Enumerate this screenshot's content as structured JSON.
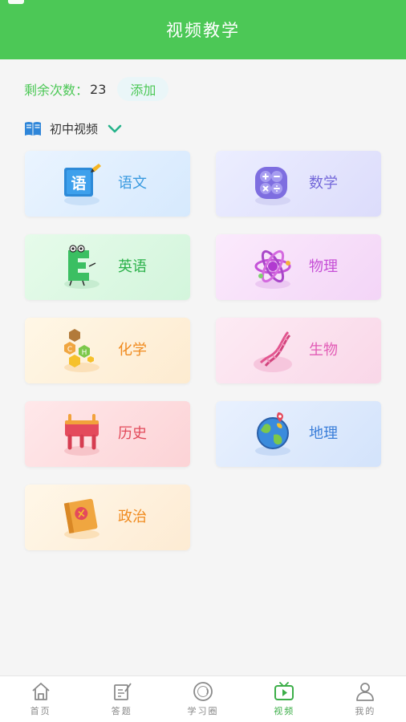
{
  "header": {
    "title": "视频教学"
  },
  "remain": {
    "label": "剩余次数：",
    "count": "23",
    "add_label": "添加"
  },
  "category": {
    "label": "初中视频"
  },
  "subjects": [
    {
      "label": "语文",
      "icon": "chinese-book-icon",
      "color": "#3b9be0"
    },
    {
      "label": "数学",
      "icon": "math-symbols-icon",
      "color": "#7367d9"
    },
    {
      "label": "英语",
      "icon": "letter-e-mascot-icon",
      "color": "#2bb14a"
    },
    {
      "label": "物理",
      "icon": "atom-icon",
      "color": "#c64fd6"
    },
    {
      "label": "化学",
      "icon": "molecule-icon",
      "color": "#f08a1e"
    },
    {
      "label": "生物",
      "icon": "dna-icon",
      "color": "#e25bb6"
    },
    {
      "label": "历史",
      "icon": "ancient-ding-icon",
      "color": "#e24a5a"
    },
    {
      "label": "地理",
      "icon": "globe-icon",
      "color": "#3a7ed9"
    },
    {
      "label": "政治",
      "icon": "party-book-icon",
      "color": "#f08a1e"
    }
  ],
  "tabbar": {
    "items": [
      {
        "label": "首页",
        "icon": "home-icon"
      },
      {
        "label": "答题",
        "icon": "edit-answer-icon"
      },
      {
        "label": "学习圈",
        "icon": "circle-icon"
      },
      {
        "label": "视频",
        "icon": "video-play-icon",
        "active": true
      },
      {
        "label": "我的",
        "icon": "user-icon"
      }
    ]
  },
  "colors": {
    "brand_green": "#4cc856",
    "active_tab": "#3cae48"
  }
}
